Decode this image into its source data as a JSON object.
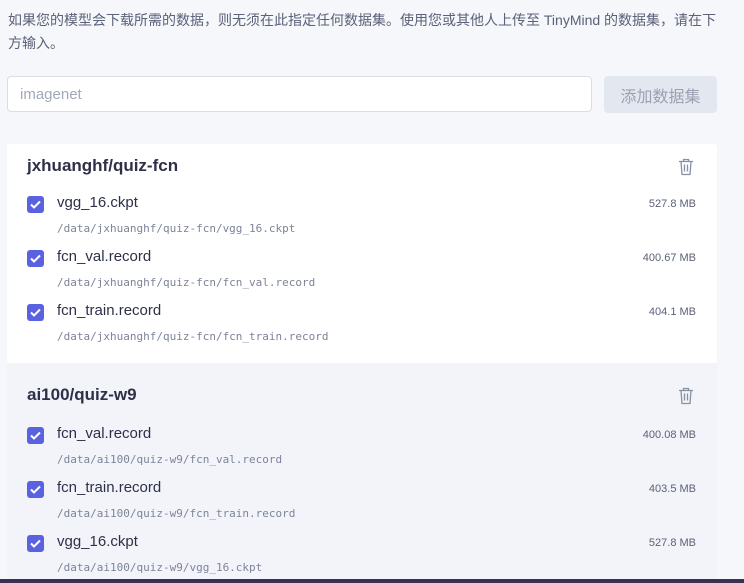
{
  "intro_text": "如果您的模型会下载所需的数据，则无须在此指定任何数据集。使用您或其他人上传至 TinyMind 的数据集，请在下方输入。",
  "search": {
    "placeholder": "imagenet",
    "value": ""
  },
  "add_button_label": "添加数据集",
  "colors": {
    "accent": "#5a62e0",
    "text": "#2d3047",
    "muted": "#7d8499"
  },
  "datasets": [
    {
      "name": "jxhuanghf/quiz-fcn",
      "files": [
        {
          "name": "vgg_16.ckpt",
          "size": "527.8 MB",
          "path": "/data/jxhuanghf/quiz-fcn/vgg_16.ckpt",
          "checked": true
        },
        {
          "name": "fcn_val.record",
          "size": "400.67 MB",
          "path": "/data/jxhuanghf/quiz-fcn/fcn_val.record",
          "checked": true
        },
        {
          "name": "fcn_train.record",
          "size": "404.1 MB",
          "path": "/data/jxhuanghf/quiz-fcn/fcn_train.record",
          "checked": true
        }
      ]
    },
    {
      "name": "ai100/quiz-w9",
      "files": [
        {
          "name": "fcn_val.record",
          "size": "400.08 MB",
          "path": "/data/ai100/quiz-w9/fcn_val.record",
          "checked": true
        },
        {
          "name": "fcn_train.record",
          "size": "403.5 MB",
          "path": "/data/ai100/quiz-w9/fcn_train.record",
          "checked": true
        },
        {
          "name": "vgg_16.ckpt",
          "size": "527.8 MB",
          "path": "/data/ai100/quiz-w9/vgg_16.ckpt",
          "checked": true
        }
      ]
    }
  ]
}
